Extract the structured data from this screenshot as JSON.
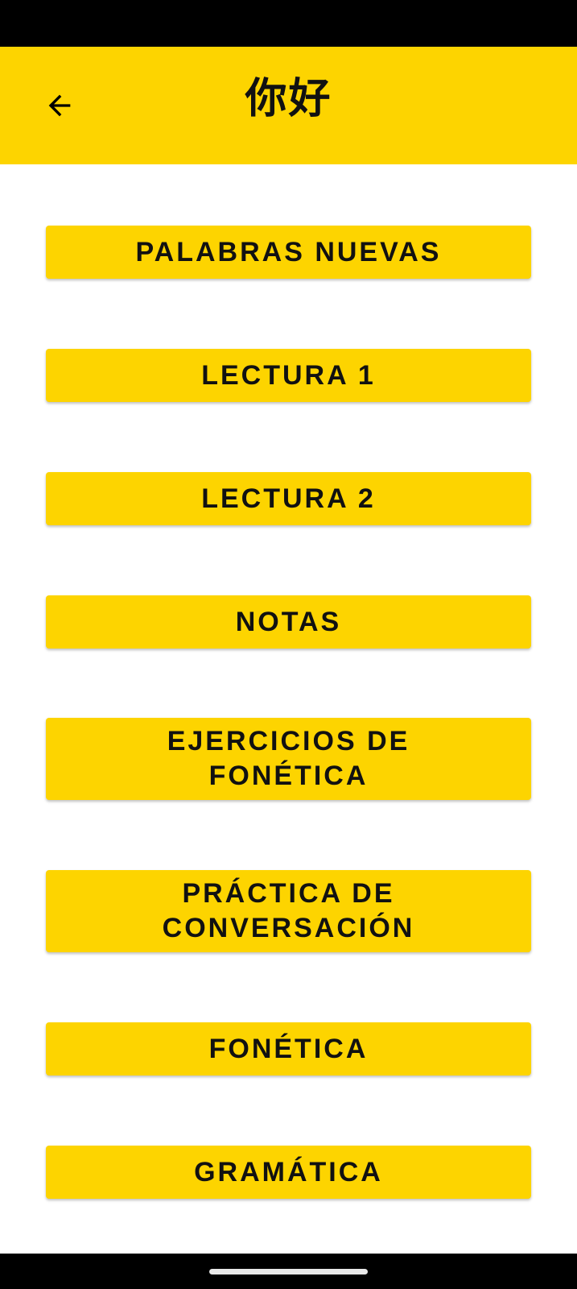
{
  "header": {
    "title": "你好",
    "back_icon": "arrow-left-icon",
    "background_color": "#FDD400"
  },
  "menu": {
    "items": [
      {
        "label": "PALABRAS NUEVAS"
      },
      {
        "label": "LECTURA 1"
      },
      {
        "label": "LECTURA 2"
      },
      {
        "label": "NOTAS"
      },
      {
        "label": "EJERCICIOS DE FONÉTICA"
      },
      {
        "label": "PRÁCTICA DE CONVERSACIÓN"
      },
      {
        "label": "FONÉTICA"
      },
      {
        "label": "GRAMÁTICA"
      }
    ],
    "button_color": "#FDD400",
    "text_color": "#111111"
  }
}
